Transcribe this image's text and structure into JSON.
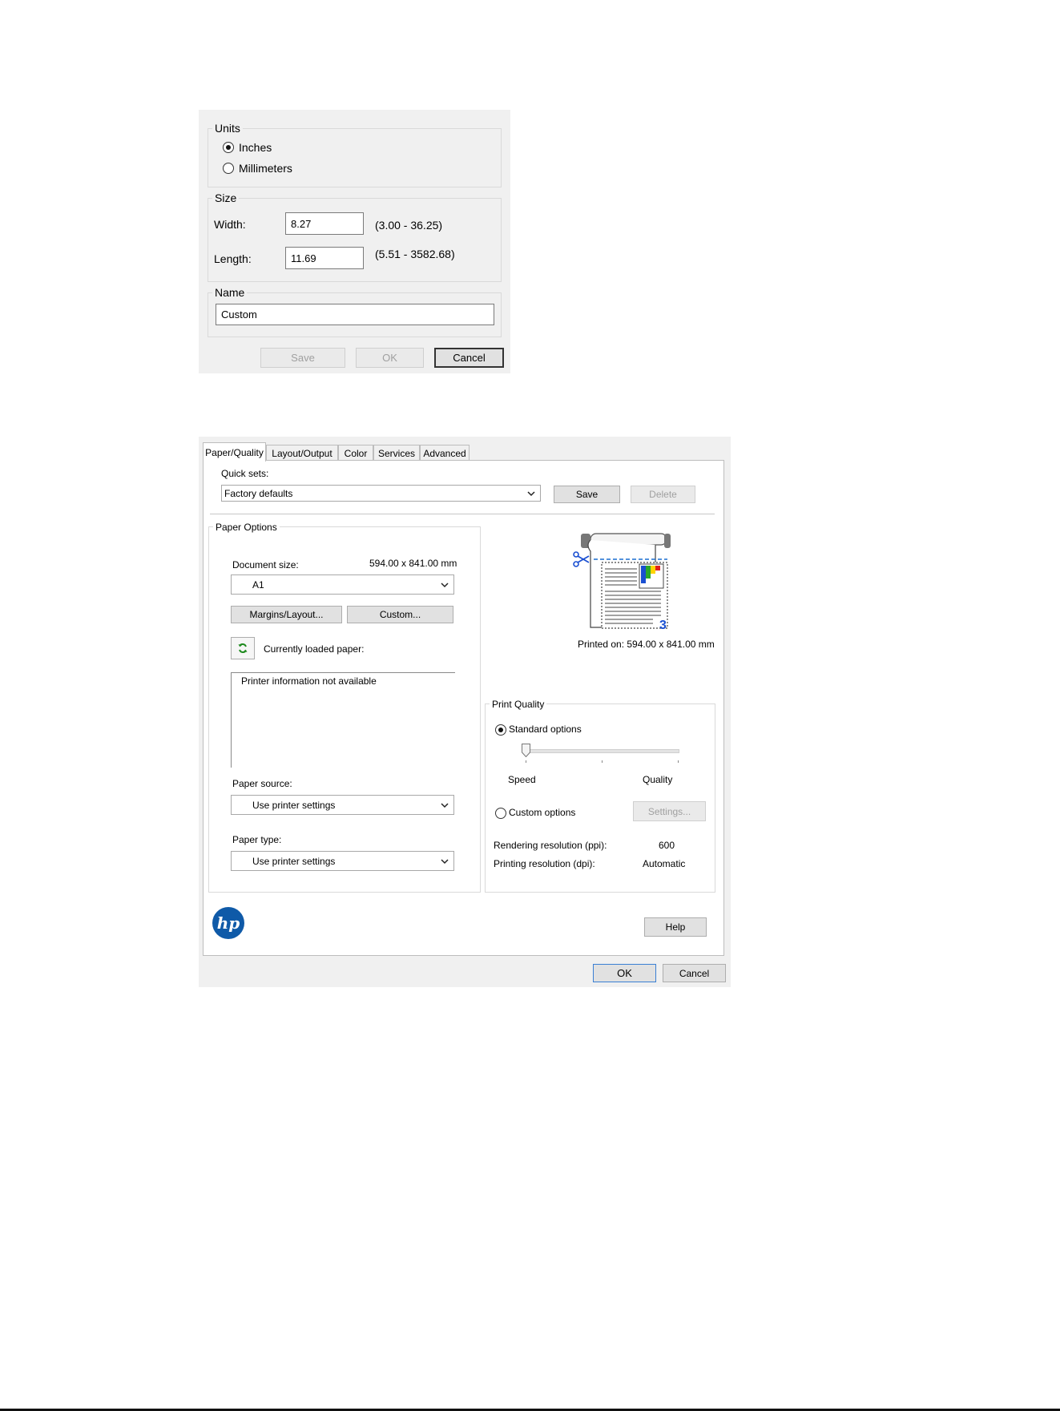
{
  "custom_size_dialog": {
    "units": {
      "title": "Units",
      "options": [
        {
          "label": "Inches",
          "selected": true
        },
        {
          "label": "Millimeters",
          "selected": false
        }
      ]
    },
    "size": {
      "title": "Size",
      "width": {
        "label": "Width:",
        "value": "8.27",
        "range": "(3.00 - 36.25)"
      },
      "length": {
        "label": "Length:",
        "value": "11.69",
        "range": "(5.51 - 3582.68)"
      }
    },
    "name": {
      "title": "Name",
      "value": "Custom"
    },
    "buttons": {
      "save": "Save",
      "ok": "OK",
      "cancel": "Cancel"
    }
  },
  "printer_dialog": {
    "tabs": [
      {
        "label": "Paper/Quality",
        "active": true
      },
      {
        "label": "Layout/Output",
        "active": false
      },
      {
        "label": "Color",
        "active": false
      },
      {
        "label": "Services",
        "active": false
      },
      {
        "label": "Advanced",
        "active": false
      }
    ],
    "quick_sets": {
      "label": "Quick sets:",
      "value": "Factory defaults",
      "save_button": "Save",
      "delete_button": "Delete"
    },
    "paper_options": {
      "title": "Paper Options",
      "document_size_label": "Document size:",
      "document_size_value": "594.00 x 841.00 mm",
      "document_size_select": "A1",
      "margins_button": "Margins/Layout...",
      "custom_button": "Custom...",
      "loaded_paper_label": "Currently loaded paper:",
      "printer_info": "Printer information not available",
      "paper_source_label": "Paper source:",
      "paper_source_value": "Use printer settings",
      "paper_type_label": "Paper type:",
      "paper_type_value": "Use printer settings"
    },
    "preview": {
      "printed_on": "Printed on: 594.00 x 841.00 mm",
      "page_marker": "3",
      "colors": {
        "roll": "#666666",
        "accent": "#1a4fd1",
        "cut_line": "#1a6fd1"
      }
    },
    "print_quality": {
      "title": "Print Quality",
      "standard_label": "Standard options",
      "standard_selected": true,
      "slider_level": 0,
      "speed_label": "Speed",
      "quality_label": "Quality",
      "custom_label": "Custom options",
      "custom_selected": false,
      "settings_button": "Settings...",
      "rendering_label": "Rendering resolution (ppi):",
      "rendering_value": "600",
      "printing_label": "Printing resolution (dpi):",
      "printing_value": "Automatic"
    },
    "logo": {
      "text": "hp",
      "color": "#0f5aa8"
    },
    "help_button": "Help",
    "ok_button": "OK",
    "cancel_button": "Cancel"
  }
}
